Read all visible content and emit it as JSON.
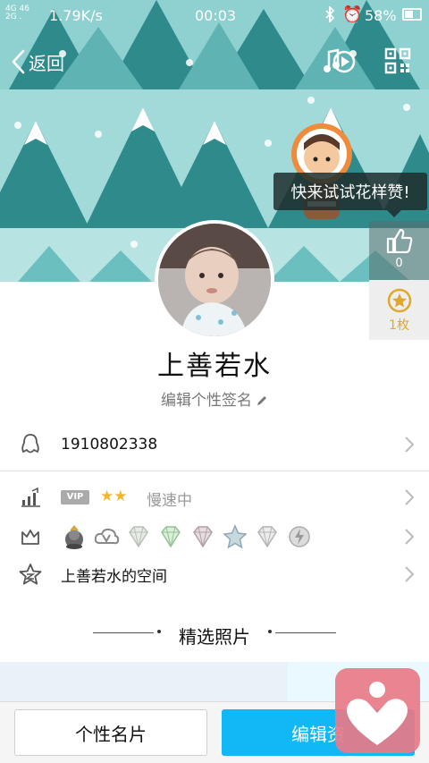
{
  "status_bar": {
    "signal_top": "4G 46",
    "signal_bottom": "2G .",
    "net_speed": "1.79K/s",
    "time": "00:03",
    "battery": "58%"
  },
  "nav": {
    "back_label": "返回"
  },
  "tooltip": {
    "text": "快来试试花样赞!"
  },
  "likes": {
    "count": "0"
  },
  "medals": {
    "count": "1枚"
  },
  "profile": {
    "nickname": "上善若水",
    "signature_placeholder": "编辑个性签名"
  },
  "rows": {
    "qq_number": "1910802338",
    "vip": {
      "badge": "VIP",
      "stars": "★★",
      "speed_text": "慢速中"
    },
    "space": "上善若水的空间"
  },
  "featured": {
    "title": "精选照片"
  },
  "bottom": {
    "card_label": "个性名片",
    "edit_label": "编辑资"
  },
  "colors": {
    "accent": "#12b7f5",
    "cover_bg": "#8fcfcf",
    "tree_dark": "#2f8b8b",
    "float_heart": "#e87a88",
    "medal_gold": "#e0a82a"
  }
}
